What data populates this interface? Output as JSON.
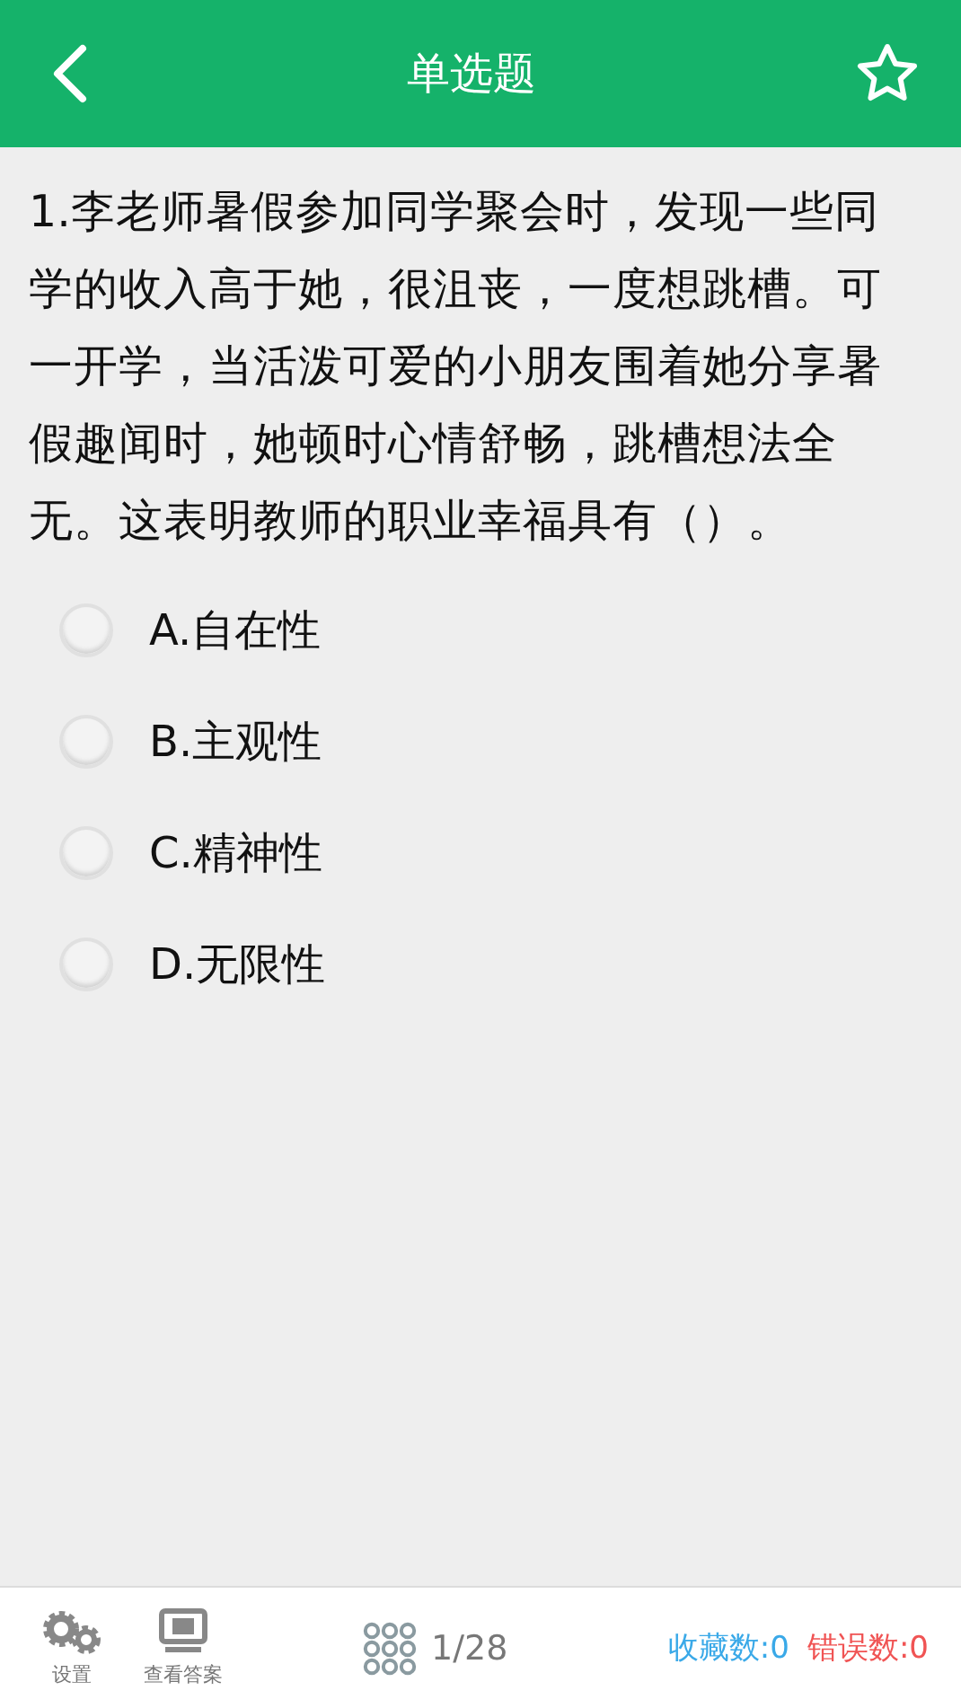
{
  "header": {
    "title": "单选题"
  },
  "question": {
    "text": "1.李老师暑假参加同学聚会时，发现一些同学的收入高于她，很沮丧，一度想跳槽。可一开学，当活泼可爱的小朋友围着她分享暑假趣闻时，她顿时心情舒畅，跳槽想法全无。这表明教师的职业幸福具有（）。"
  },
  "options": [
    {
      "label": "A.自在性",
      "selected": false
    },
    {
      "label": "B.主观性",
      "selected": false
    },
    {
      "label": "C.精神性",
      "selected": false
    },
    {
      "label": "D.无限性",
      "selected": false
    }
  ],
  "bottom_bar": {
    "settings_label": "设置",
    "answer_label": "查看答案",
    "progress": "1/28",
    "favorites": "收藏数:0",
    "errors": "错误数:0"
  }
}
